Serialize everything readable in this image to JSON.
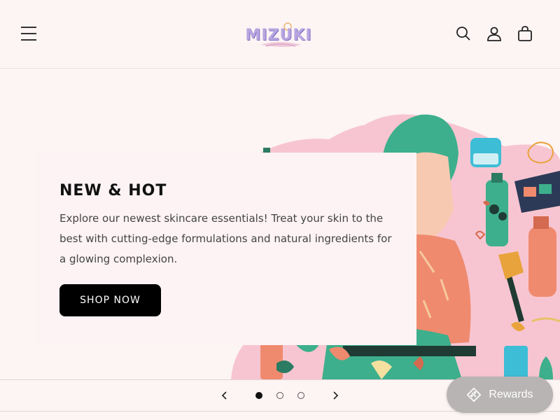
{
  "header": {
    "logo_text": "MIZUKI",
    "menu_icon": "hamburger-menu-icon",
    "search_icon": "search-icon",
    "account_icon": "user-icon",
    "cart_icon": "shopping-bag-icon"
  },
  "hero": {
    "title": "NEW & HOT",
    "description": "Explore our newest skincare essentials! Treat your skin to the best with cutting-edge formulations and natural ingredients for a glowing complexion.",
    "cta_label": "SHOP NOW"
  },
  "slider": {
    "slide_count": 3,
    "active_slide": 1,
    "prev_icon": "chevron-left-icon",
    "next_icon": "chevron-right-icon"
  },
  "rewards": {
    "label": "Rewards",
    "icon": "ticket-icon"
  },
  "colors": {
    "background": "#fdf4f4",
    "button": "#000000",
    "logo": "#b6a6e0",
    "rewards_bg": "#b8b4b4",
    "hero_pink": "#f6c3cf",
    "hero_teal": "#3daf8c"
  }
}
